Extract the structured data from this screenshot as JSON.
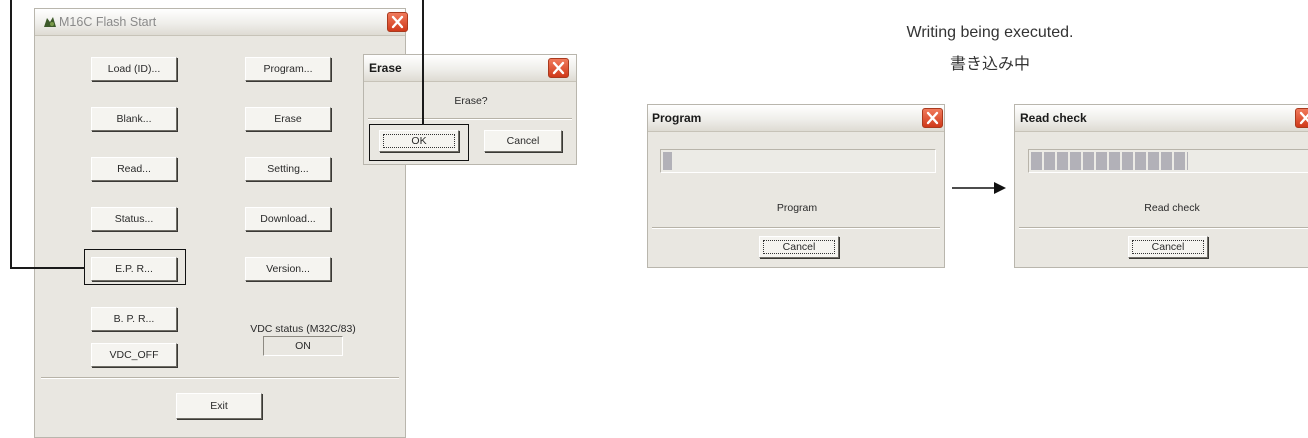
{
  "main_window": {
    "title": "M16C Flash Start",
    "buttons": {
      "load": "Load (ID)...",
      "program": "Program...",
      "blank": "Blank...",
      "erase": "Erase",
      "read": "Read...",
      "setting": "Setting...",
      "status": "Status...",
      "download": "Download...",
      "epr": "E.P. R...",
      "version": "Version...",
      "bpr": "B. P. R...",
      "vdc_off": "VDC_OFF",
      "exit": "Exit"
    },
    "vdc_status_label": "VDC status (M32C/83)",
    "vdc_status_value": "ON"
  },
  "erase_dialog": {
    "title": "Erase",
    "message": "Erase?",
    "ok": "OK",
    "cancel": "Cancel"
  },
  "caption": {
    "english": "Writing being executed.",
    "japanese": "書き込み中"
  },
  "program_dialog": {
    "title": "Program",
    "status": "Program",
    "cancel": "Cancel",
    "progress": 0.03
  },
  "read_check_dialog": {
    "title": "Read check",
    "status": "Read check",
    "cancel": "Cancel",
    "progress": 0.55
  },
  "colors": {
    "close_button": "#d0391a",
    "dialog_background": "#e9e7e1",
    "progress_fill": "#b2b1b8"
  }
}
